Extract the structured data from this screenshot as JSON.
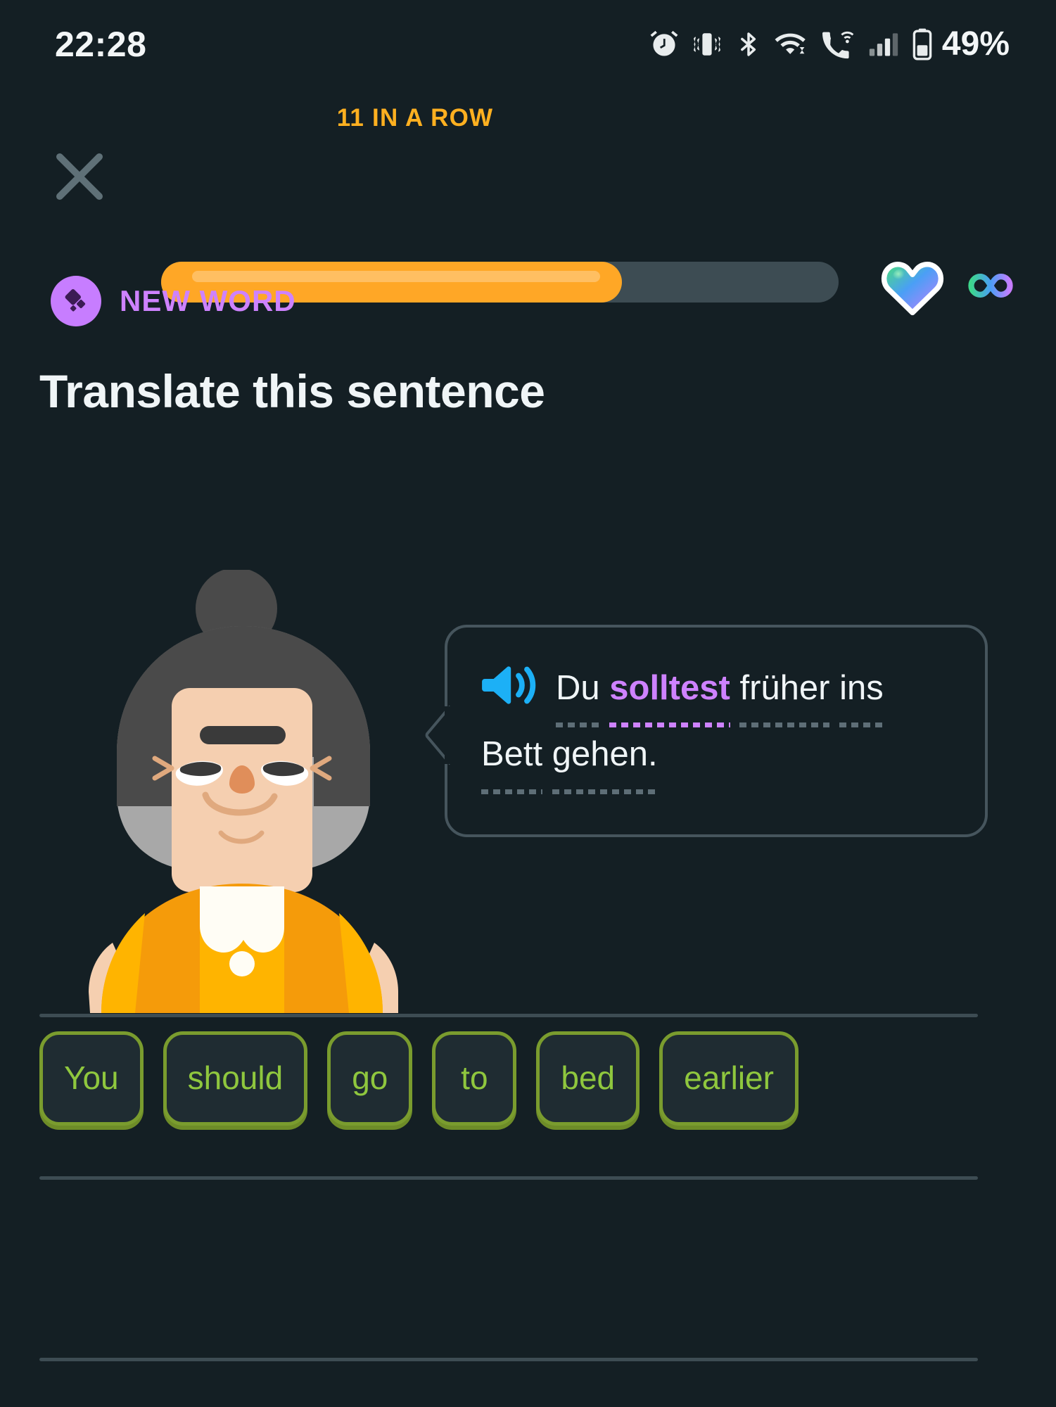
{
  "statusbar": {
    "time": "22:28",
    "battery_percent": "49%",
    "icons": [
      "alarm-icon",
      "vibrate-icon",
      "bluetooth-icon",
      "wifi-icon",
      "wifi-calling-icon",
      "cellular-signal-icon",
      "battery-icon"
    ]
  },
  "topnav": {
    "close_label": "close-icon",
    "streak_label": "11 IN A ROW",
    "progress_percent": 68,
    "hearts_icon": "gradient-heart-icon",
    "infinity_icon": "infinity-icon"
  },
  "challenge": {
    "badge_label": "NEW WORD",
    "badge_icon": "sparkle-diamond-icon",
    "title": "Translate this sentence",
    "character": "lucy-avatar",
    "speaker_icon": "speaker-icon",
    "prompt_line1": [
      {
        "text": "Du",
        "highlight": false
      },
      {
        "text": "solltest",
        "highlight": true
      },
      {
        "text": "früher",
        "highlight": false
      },
      {
        "text": "ins",
        "highlight": false
      }
    ],
    "prompt_line2": [
      {
        "text": "Bett",
        "highlight": false
      },
      {
        "text": "gehen.",
        "highlight": false
      }
    ],
    "full_prompt": "Du solltest früher ins Bett gehen."
  },
  "wordbank": {
    "tiles": [
      "You",
      "should",
      "go",
      "to",
      "bed",
      "earlier"
    ]
  },
  "colors": {
    "background": "#141f24",
    "accent_orange": "#ffa726",
    "streak_text": "#ffb020",
    "purple": "#ce82ff",
    "tile_green": "#8fc73e",
    "tile_border": "#7a9c2e",
    "speaker_blue": "#1cb0f6",
    "divider": "#3d4c53",
    "text_primary": "#f0f5f7"
  }
}
